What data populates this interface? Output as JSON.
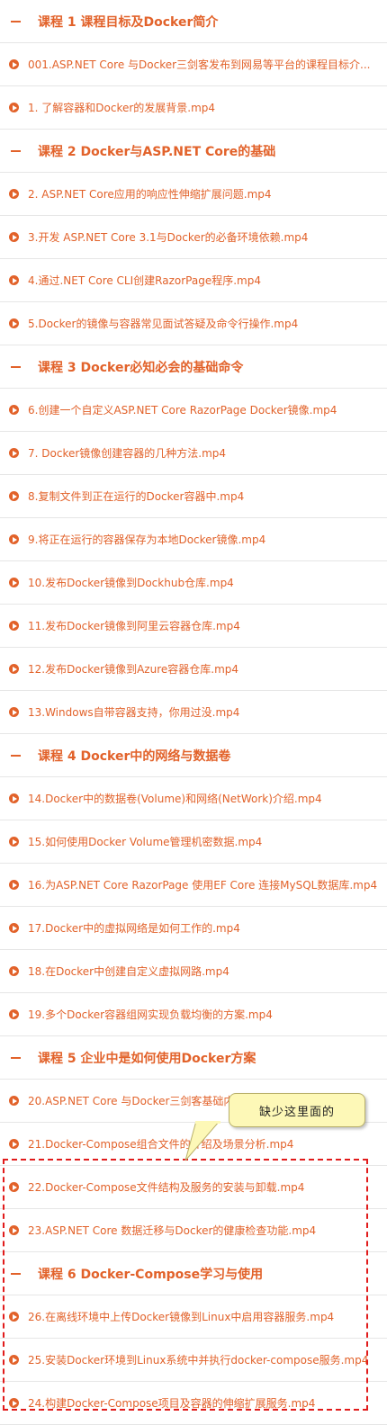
{
  "sections": [
    {
      "title": "课程 1 课程目标及Docker简介",
      "items": [
        "001.ASP.NET Core 与Docker三剑客发布到网易等平台的课程目标介...",
        "1. 了解容器和Docker的发展背景.mp4"
      ]
    },
    {
      "title": "课程 2 Docker与ASP.NET Core的基础",
      "items": [
        "2. ASP.NET Core应用的响应性伸缩扩展问题.mp4",
        "3.开发 ASP.NET Core 3.1与Docker的必备环境依赖.mp4",
        "4.通过.NET Core CLI创建RazorPage程序.mp4",
        "5.Docker的镜像与容器常见面试答疑及命令行操作.mp4"
      ]
    },
    {
      "title": "课程 3 Docker必知必会的基础命令",
      "items": [
        "6.创建一个自定义ASP.NET Core RazorPage Docker镜像.mp4",
        "7. Docker镜像创建容器的几种方法.mp4",
        "8.复制文件到正在运行的Docker容器中.mp4",
        "9.将正在运行的容器保存为本地Docker镜像.mp4",
        "10.发布Docker镜像到Dockhub仓库.mp4",
        "11.发布Docker镜像到阿里云容器仓库.mp4",
        "12.发布Docker镜像到Azure容器仓库.mp4",
        "13.Windows自带容器支持，你用过没.mp4"
      ]
    },
    {
      "title": "课程 4 Docker中的网络与数据卷",
      "items": [
        "14.Docker中的数据卷(Volume)和网络(NetWork)介绍.mp4",
        "15.如何使用Docker Volume管理机密数据.mp4",
        "16.为ASP.NET Core RazorPage 使用EF Core 连接MySQL数据库.mp4",
        "17.Docker中的虚拟网络是如何工作的.mp4",
        "18.在Docker中创建自定义虚拟网路.mp4",
        "19.多个Docker容器组网实现负载均衡的方案.mp4"
      ]
    },
    {
      "title": "课程 5 企业中是如何使用Docker方案",
      "items": [
        "20.ASP.NET Core 与Docker三剑客基础内容小结.mp4",
        "21.Docker-Compose组合文件的介绍及场景分析.mp4",
        "22.Docker-Compose文件结构及服务的安装与卸载.mp4",
        "23.ASP.NET Core 数据迁移与Docker的健康检查功能.mp4"
      ]
    },
    {
      "title": "课程 6 Docker-Compose学习与使用",
      "items": [
        "26.在离线环境中上传Docker镜像到Linux中启用容器服务.mp4",
        "25.安装Docker环境到Linux系统中并执行docker-compose服务.mp4",
        "24.构建Docker-Compose项目及容器的伸缩扩展服务.mp4"
      ]
    }
  ],
  "annotation": {
    "callout_text": "缺少这里面的",
    "highlight_color": "#e11b1b",
    "callout_bg": "#fdf8b7"
  },
  "colors": {
    "accent": "#e2622a",
    "divider": "#e6e6e6"
  },
  "icons": {
    "section_marker": "collapse-dash-icon",
    "item_marker": "play-circle-icon"
  }
}
